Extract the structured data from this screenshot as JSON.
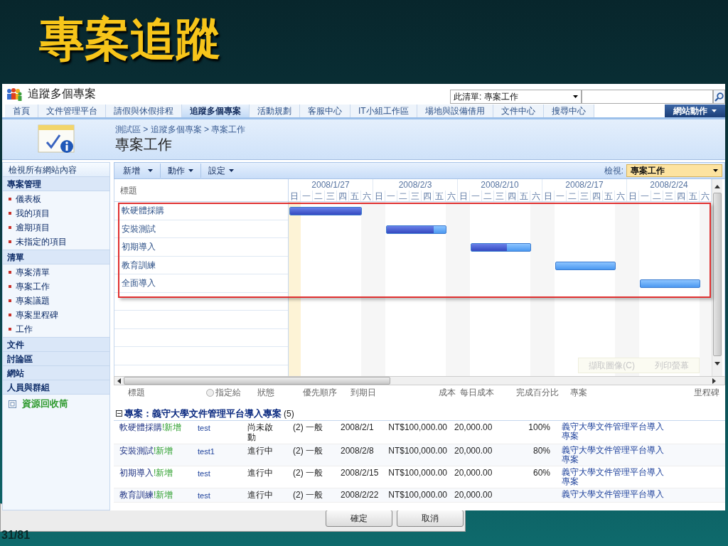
{
  "slide": {
    "title": "專案追蹤",
    "page_number": "31/81"
  },
  "site": {
    "title": "追蹤多個專案",
    "search_scope": "此清單: 專案工作"
  },
  "nav_tabs": [
    {
      "label": "首頁",
      "selected": false
    },
    {
      "label": "文件管理平台",
      "selected": false
    },
    {
      "label": "請假與休假排程",
      "selected": false
    },
    {
      "label": "追蹤多個專案",
      "selected": true
    },
    {
      "label": "活動規劃",
      "selected": false
    },
    {
      "label": "客服中心",
      "selected": false
    },
    {
      "label": "IT小組工作區",
      "selected": false
    },
    {
      "label": "場地與設備借用",
      "selected": false
    },
    {
      "label": "文件中心",
      "selected": false
    },
    {
      "label": "搜尋中心",
      "selected": false
    }
  ],
  "site_actions": "網站動作",
  "breadcrumb": "測試區 > 追蹤多個專案 > 專案工作",
  "page_title": "專案工作",
  "quick_launch": {
    "view_all": "檢視所有網站內容",
    "sections": [
      {
        "heading": "專案管理",
        "items": [
          "儀表板",
          "我的項目",
          "逾期項目",
          "未指定的項目"
        ]
      },
      {
        "heading": "清單",
        "items": [
          "專案清單",
          "專案工作",
          "專案議題",
          "專案里程碑",
          "工作"
        ]
      },
      {
        "heading": "文件"
      },
      {
        "heading": "討論區"
      },
      {
        "heading": "網站"
      },
      {
        "heading": "人員與群組"
      }
    ],
    "recycle_bin": "資源回收筒"
  },
  "toolbar": {
    "menus": [
      "新增",
      "動作",
      "設定"
    ],
    "view_label": "檢視:",
    "view_value": "專案工作"
  },
  "gantt": {
    "title_header": "標題",
    "weeks": [
      {
        "label": "2008/1/27",
        "days": [
          "日",
          "一",
          "二",
          "三",
          "四",
          "五",
          "六"
        ]
      },
      {
        "label": "2008/2/3",
        "days": [
          "日",
          "一",
          "二",
          "三",
          "四",
          "五",
          "六"
        ]
      },
      {
        "label": "2008/2/10",
        "days": [
          "日",
          "一",
          "二",
          "三",
          "四",
          "五",
          "六"
        ]
      },
      {
        "label": "2008/2/17",
        "days": [
          "日",
          "一",
          "二",
          "三",
          "四",
          "五",
          "六"
        ]
      },
      {
        "label": "2008/2/24",
        "days": [
          "日",
          "一",
          "二",
          "三",
          "四",
          "五",
          "六"
        ]
      }
    ],
    "tasks": [
      {
        "title": "軟硬體採購",
        "level": 1
      },
      {
        "title": "安裝測試",
        "level": 0.8
      },
      {
        "title": "初期導入",
        "level": 0.6
      },
      {
        "title": "教育訓練",
        "level": 0
      },
      {
        "title": "全面導入",
        "level": 0
      }
    ],
    "buttons": [
      "擷取圖像(C)",
      "列印螢幕"
    ]
  },
  "list": {
    "columns": [
      "標題",
      "指定給",
      "狀態",
      "優先順序",
      "到期日",
      "成本",
      "每日成本",
      "完成百分比",
      "專案",
      "里程碑"
    ],
    "group": {
      "label": "專案：義守大學文件管理平台導入專案",
      "count": "(5)"
    },
    "rows": [
      {
        "title": "軟硬體採購",
        "badge": "!新增",
        "assigned": "test",
        "status": "尚未啟動",
        "priority": "(2) 一般",
        "due": "2008/2/1",
        "cost": "NT$100,000.00",
        "daily_cost": "20,000.00",
        "percent": "100%",
        "project": "義守大學文件管理平台導入專案"
      },
      {
        "title": "安裝測試",
        "badge": "!新增",
        "assigned": "test1",
        "status": "進行中",
        "priority": "(2) 一般",
        "due": "2008/2/8",
        "cost": "NT$100,000.00",
        "daily_cost": "20,000.00",
        "percent": "80%",
        "project": "義守大學文件管理平台導入專案"
      },
      {
        "title": "初期導入",
        "badge": "!新增",
        "assigned": "test",
        "status": "進行中",
        "priority": "(2) 一般",
        "due": "2008/2/15",
        "cost": "NT$100,000.00",
        "daily_cost": "20,000.00",
        "percent": "60%",
        "project": "義守大學文件管理平台導入專案"
      },
      {
        "title": "教育訓練",
        "badge": "!新增",
        "assigned": "test",
        "status": "進行中",
        "priority": "(2) 一般",
        "due": "2008/2/22",
        "cost": "NT$100,000.00",
        "daily_cost": "20,000.00",
        "project": "義守大學文件管理平台導入"
      }
    ]
  },
  "dialog_buttons": [
    "確定",
    "取消"
  ]
}
